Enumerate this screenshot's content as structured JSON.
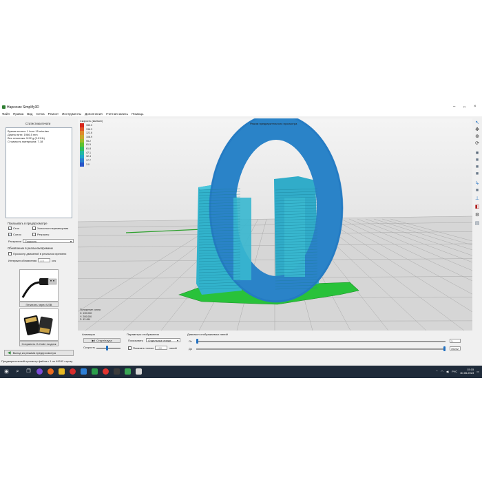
{
  "window": {
    "title": "Нарезчик Simplify3D",
    "minimize": "–",
    "maximize": "□",
    "close": "×"
  },
  "menu": [
    "Файл",
    "Правка",
    "Вид",
    "Сетка",
    "Ремонт",
    "Инструменты",
    "Дополнения",
    "Учетная запись",
    "Помощь"
  ],
  "stats": {
    "title": "Статистика печати",
    "lines": [
      "Время печати: 1 hour 15 minutes",
      "Длина нити: 1966.5 mm",
      "Вес пластика: 5.92 g (0.01 lb)",
      "Стоимость материала: 7.18"
    ]
  },
  "preview_options": {
    "title": "Показывать в предпросмотре",
    "items": [
      {
        "label": "Стол",
        "checked": true
      },
      {
        "label": "Холостые перемещения",
        "checked": false
      },
      {
        "label": "Сопло",
        "checked": true
      },
      {
        "label": "Ретракты",
        "checked": false
      }
    ],
    "coloring_label": "Раскраска",
    "coloring_value": "Скорость"
  },
  "realtime": {
    "title": "Обновление в реальном времени",
    "checkbox_label": "Просмотр движений в реальном времени",
    "checked": false,
    "interval_label": "Интервал обновления",
    "interval_value": "3.0",
    "interval_unit": "сек"
  },
  "buttons": {
    "print_usb": "Печатать через USB",
    "save_gcode": "Сохранить G-Code на диск",
    "exit_preview": "Выход из режима предпросмотра"
  },
  "viewport": {
    "title": "Режим предварительного просмотра",
    "legend_title": "Скорость (мм/мин)",
    "legend_items": [
      {
        "value": "150.0",
        "color": "#d7261c"
      },
      {
        "value": "136.3",
        "color": "#e0552a"
      },
      {
        "value": "122.6",
        "color": "#de8a2c"
      },
      {
        "value": "108.9",
        "color": "#c9a62a"
      },
      {
        "value": "95.2",
        "color": "#9fbd2a"
      },
      {
        "value": "81.5",
        "color": "#5fc22f"
      },
      {
        "value": "61.8",
        "color": "#2fbf5e"
      },
      {
        "value": "47.1",
        "color": "#22b8a2"
      },
      {
        "value": "32.4",
        "color": "#1fa6c9"
      },
      {
        "value": "17.7",
        "color": "#2a7fd1"
      },
      {
        "value": "3.0",
        "color": "#2a55c8"
      }
    ],
    "coords_title": "Положение сопла",
    "coords": [
      "X: 190.000",
      "Y: 200.000",
      "Z: 43.494"
    ]
  },
  "animation": {
    "title": "Анимация",
    "start_pause": "Старт/пауза",
    "speed_label": "Скорость",
    "speed_level": 0.45
  },
  "display": {
    "title": "Параметры отображения",
    "show_label": "Показывать",
    "show_value": "Отдельные линии",
    "only_label": "Показать только",
    "only_checked": false,
    "only_value": "100",
    "only_unit": "линий"
  },
  "range": {
    "title": "Диапазон отображаемых линий",
    "from_label": "От",
    "from_value": "1",
    "to_label": "До",
    "to_value": "49242",
    "from_level": 0.0,
    "to_level": 1.0
  },
  "status": "Предварительный просмотр файла с 1 по 49242 строку",
  "taskbar": {
    "lang": "РУС",
    "time": "15:15",
    "date": "30.06.2023"
  }
}
